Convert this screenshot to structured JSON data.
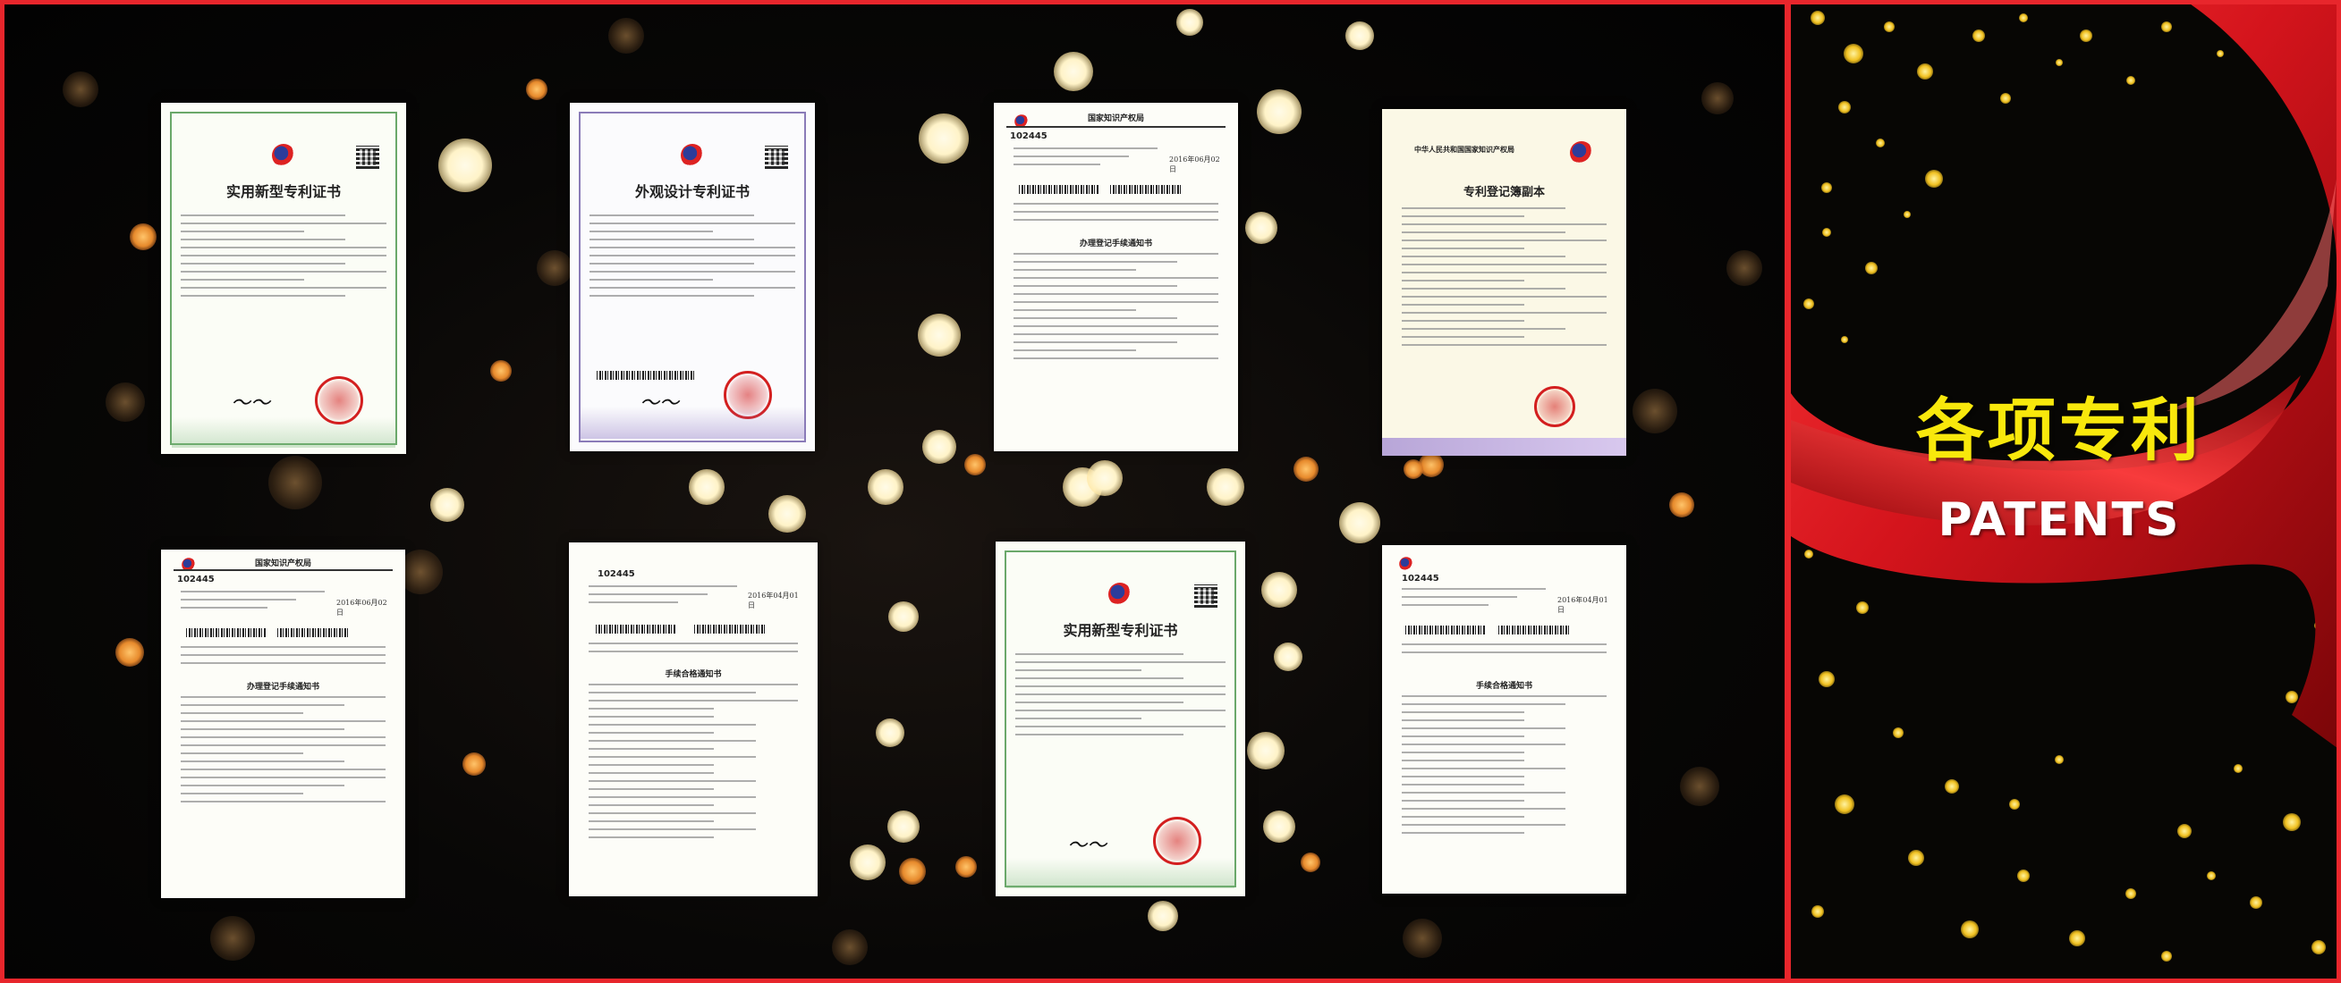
{
  "right_panel": {
    "title_cn": "各项专利",
    "title_en": "PATENTS"
  },
  "colors": {
    "frame": "#e8262c",
    "title_cn": "#f8e80c",
    "title_en": "#ffffff",
    "ribbon": "#d4141c"
  },
  "certificates": [
    {
      "id": "cert-1",
      "style": "green",
      "title": "实用新型专利证书",
      "signature": "申长雨"
    },
    {
      "id": "cert-2",
      "style": "purple",
      "title": "外观设计专利证书",
      "signature": "申长雨"
    },
    {
      "id": "cert-3",
      "style": "notice",
      "header": "国家知识产权局",
      "number": "102445",
      "date": "2016年06月02日",
      "notice_title": "办理登记手续通知书"
    },
    {
      "id": "cert-4",
      "style": "register",
      "header": "中华人民共和国国家知识产权局",
      "title": "专利登记簿副本"
    },
    {
      "id": "cert-5",
      "style": "notice",
      "header": "国家知识产权局",
      "number": "102445",
      "date": "2016年06月02日",
      "notice_title": "办理登记手续通知书"
    },
    {
      "id": "cert-6",
      "style": "notice",
      "number": "102445",
      "date": "2016年04月01日",
      "notice_title": "手续合格通知书"
    },
    {
      "id": "cert-7",
      "style": "green",
      "title": "实用新型专利证书",
      "signature": "申长雨"
    },
    {
      "id": "cert-8",
      "style": "notice",
      "number": "102445",
      "date": "2016年04月01日",
      "notice_title": "手续合格通知书"
    }
  ]
}
